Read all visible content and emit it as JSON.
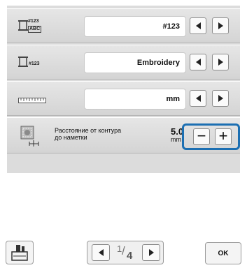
{
  "rows": [
    {
      "icon_text_top": "#123",
      "icon_text_bottom": "ABC",
      "value": "#123"
    },
    {
      "icon_text": "#123",
      "value": "Embroidery"
    },
    {
      "value": "mm"
    }
  ],
  "distance_row": {
    "label_line1": "Расстояние от контура",
    "label_line2": "до наметки",
    "value": "5.0",
    "unit": "mm",
    "minus_label": "−",
    "plus_label": "+"
  },
  "pager": {
    "current": "1",
    "total": "4"
  },
  "ok_label": "OK",
  "colors": {
    "highlight": "#1c6fb2",
    "panel": "#dcdcdc"
  }
}
